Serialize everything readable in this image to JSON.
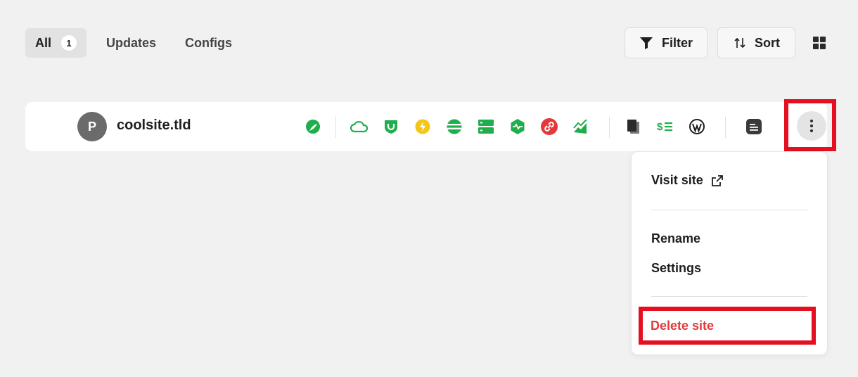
{
  "tabs": {
    "all": {
      "label": "All",
      "count": "1"
    },
    "updates": {
      "label": "Updates"
    },
    "configs": {
      "label": "Configs"
    }
  },
  "toolbar": {
    "filter_label": "Filter",
    "sort_label": "Sort"
  },
  "site": {
    "avatar_letter": "P",
    "name": "coolsite.tld",
    "icons": [
      "leaf-icon",
      "cloud-icon",
      "shield-icon",
      "lightning-icon",
      "globe-icon",
      "server-icon",
      "pulse-icon",
      "link-icon",
      "chart-icon",
      "pages-icon",
      "dollar-list-icon",
      "wordpress-icon",
      "note-icon"
    ]
  },
  "menu": {
    "visit_label": "Visit site",
    "rename_label": "Rename",
    "settings_label": "Settings",
    "delete_label": "Delete site"
  },
  "colors": {
    "accent_green": "#1fae4b",
    "warning_yellow": "#f5c518",
    "error_red": "#e5383b",
    "highlight_red": "#e4101f"
  }
}
